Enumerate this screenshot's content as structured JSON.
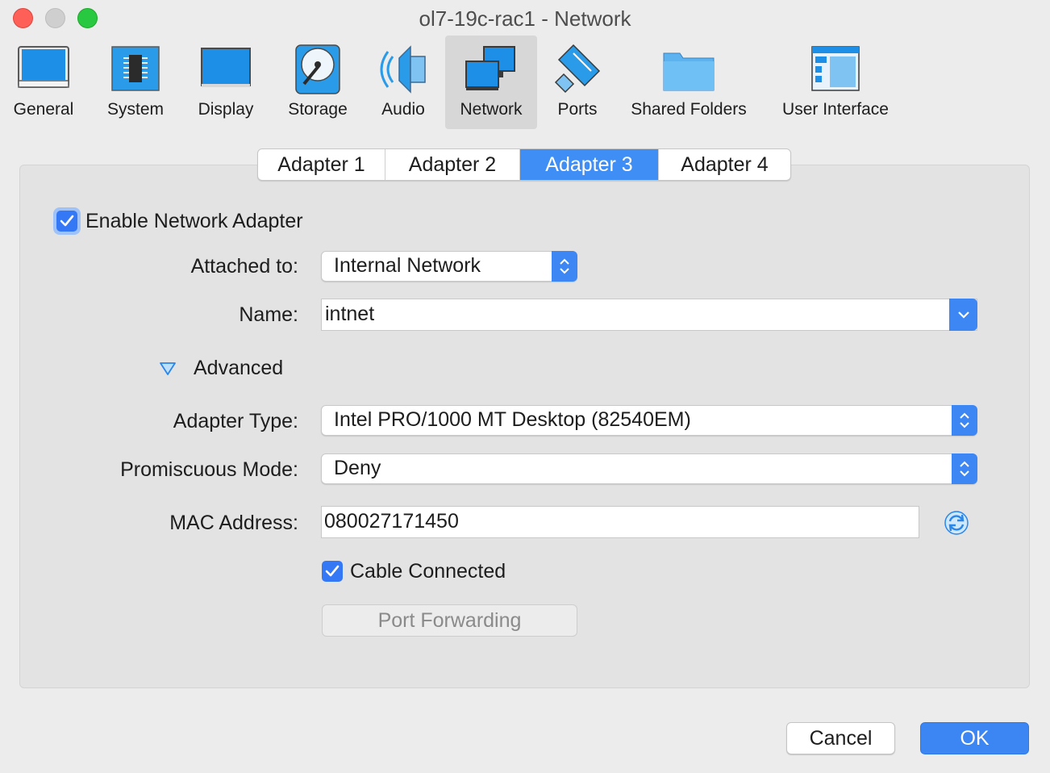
{
  "window": {
    "title": "ol7-19c-rac1 - Network"
  },
  "toolbar": {
    "items": [
      {
        "label": "General",
        "icon": "general-icon"
      },
      {
        "label": "System",
        "icon": "system-chip-icon"
      },
      {
        "label": "Display",
        "icon": "display-monitor-icon"
      },
      {
        "label": "Storage",
        "icon": "storage-disk-icon"
      },
      {
        "label": "Audio",
        "icon": "audio-speaker-icon"
      },
      {
        "label": "Network",
        "icon": "network-icon",
        "selected": true
      },
      {
        "label": "Ports",
        "icon": "ports-plug-icon"
      },
      {
        "label": "Shared Folders",
        "icon": "folder-icon"
      },
      {
        "label": "User Interface",
        "icon": "user-interface-window-icon"
      }
    ]
  },
  "tabs": [
    {
      "label": "Adapter 1"
    },
    {
      "label": "Adapter 2"
    },
    {
      "label": "Adapter 3",
      "active": true
    },
    {
      "label": "Adapter 4"
    }
  ],
  "adapter": {
    "enable_label": "Enable Network Adapter",
    "enabled": true,
    "attached_label": "Attached to:",
    "attached_value": "Internal Network",
    "name_label": "Name:",
    "name_value": "intnet",
    "advanced_label": "Advanced",
    "adapter_type_label": "Adapter Type:",
    "adapter_type_value": "Intel PRO/1000 MT Desktop (82540EM)",
    "promiscuous_label": "Promiscuous Mode:",
    "promiscuous_value": "Deny",
    "mac_label": "MAC Address:",
    "mac_value": "080027171450",
    "cable_label": "Cable Connected",
    "cable_connected": true,
    "port_forwarding_label": "Port Forwarding"
  },
  "footer": {
    "cancel_label": "Cancel",
    "ok_label": "OK"
  },
  "colors": {
    "accent": "#3b86f2",
    "selected_tab": "#3f8ef5",
    "panel": "#e3e3e3",
    "window": "#ececec"
  }
}
